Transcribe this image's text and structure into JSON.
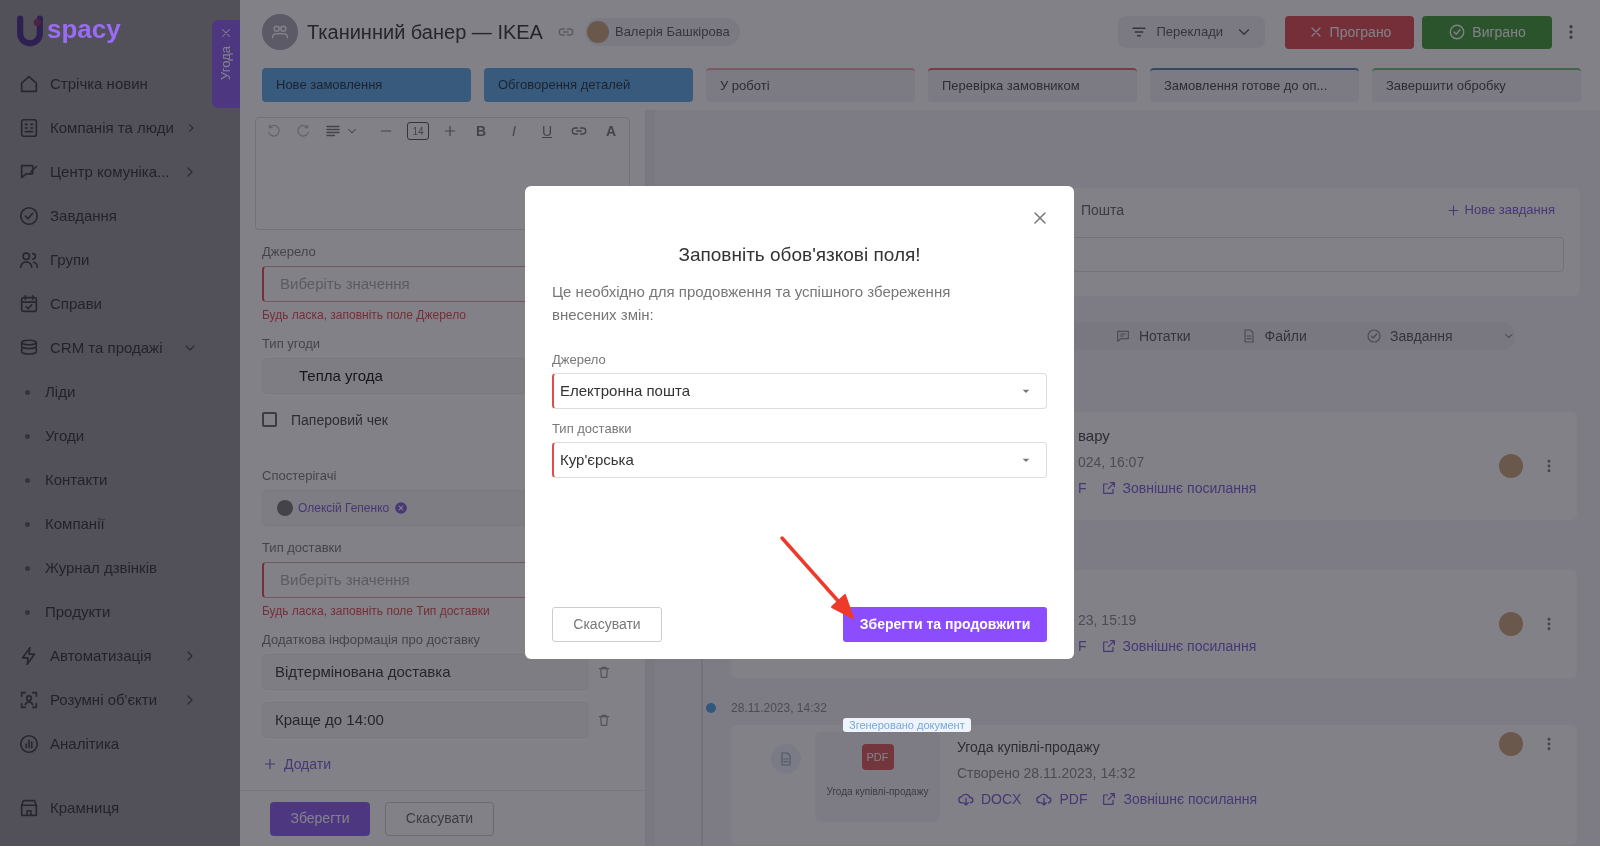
{
  "sidebar": {
    "logo": "spacy",
    "items": [
      {
        "label": "Стрічка новин"
      },
      {
        "label": "Компанія та люди",
        "expanded": false
      },
      {
        "label": "Центр комуніка...",
        "expanded": false
      },
      {
        "label": "Завдання"
      },
      {
        "label": "Групи"
      },
      {
        "label": "Справи"
      },
      {
        "label": "CRM та продажі",
        "expanded": true,
        "children": [
          {
            "label": "Ліди"
          },
          {
            "label": "Угоди"
          },
          {
            "label": "Контакти"
          },
          {
            "label": "Компанії"
          },
          {
            "label": "Журнал дзвінків"
          },
          {
            "label": "Продукти"
          }
        ]
      },
      {
        "label": "Автоматизація",
        "expanded": false
      },
      {
        "label": "Розумні об'єкти",
        "expanded": false
      },
      {
        "label": "Аналітика"
      },
      {
        "label": "Крамниця"
      }
    ]
  },
  "drawer_tab": {
    "label": "Угода"
  },
  "header": {
    "title": "Тканинний банер — IKEA",
    "owner": "Валерія Башкірова",
    "translations": "Переклади",
    "lost": "Програно",
    "won": "Виграно"
  },
  "stages": [
    {
      "label": "Нове замовлення",
      "done": true
    },
    {
      "label": "Обговорення деталей",
      "done": true
    },
    {
      "label": "У роботі",
      "done": false
    },
    {
      "label": "Перевірка замовником",
      "done": false
    },
    {
      "label": "Замовлення готове до оп...",
      "done": false
    },
    {
      "label": "Завершити обробку",
      "done": false
    }
  ],
  "form": {
    "editor": {
      "font_size": "14",
      "format": [
        "B",
        "I",
        "U",
        "A"
      ]
    },
    "fields": [
      {
        "kind": "select",
        "label": "Джерело",
        "placeholder": "Виберіть значення",
        "invalid": true,
        "error": "Будь ласка, заповніть поле Джерело"
      },
      {
        "kind": "select",
        "label": "Тип угоди",
        "value": "Тепла угода",
        "invalid": false
      },
      {
        "kind": "checkbox",
        "label": "Паперовий чек",
        "checked": false
      },
      {
        "kind": "people",
        "label": "Спостерігачі",
        "people": [
          "Олексій Гепенко"
        ]
      },
      {
        "kind": "select",
        "label": "Тип доставки",
        "placeholder": "Виберіть значення",
        "invalid": true,
        "error": "Будь ласка, заповніть поле Тип доставки"
      },
      {
        "kind": "list",
        "label": "Додаткова інформація про доставку",
        "values": [
          "Відтермінована доставка",
          "Краще до 14:00"
        ],
        "add": "Додати"
      }
    ],
    "save": "Зберегти",
    "cancel": "Скасувати"
  },
  "activity": {
    "tab": "Пошта",
    "new_task": "Нове завдання",
    "feed_tabs": [
      "Нотатки",
      "Файли",
      "Завдання"
    ],
    "entries": [
      {
        "kind": "partial",
        "title": "вару",
        "date": "024, 16:07",
        "links": [
          {
            "label": "F",
            "kind": "text"
          },
          {
            "label": "Зовнішнє посилання",
            "kind": "external"
          }
        ]
      },
      {
        "kind": "partial",
        "date": "23, 15:19",
        "links": [
          {
            "label": "F",
            "kind": "text"
          },
          {
            "label": "Зовнішнє посилання",
            "kind": "external"
          }
        ]
      },
      {
        "kind": "document",
        "time": "28.11.2023, 14:32",
        "tag": "Згенеровано документ",
        "badge": "PDF",
        "caption": "Угода купівлі-продажу",
        "title": "Угода купівлі-продажу",
        "date": "Створено 28.11.2023, 14:32",
        "links": [
          {
            "label": "DOCX",
            "kind": "download"
          },
          {
            "label": "PDF",
            "kind": "download"
          },
          {
            "label": "Зовнішнє посилання",
            "kind": "external"
          }
        ]
      }
    ]
  },
  "modal": {
    "title": "Заповніть обов'язкові поля!",
    "message": "Це необхідно для продовження та успішного збереження внесених змін:",
    "fields": [
      {
        "label": "Джерело",
        "value": "Електронна пошта",
        "invalid": true
      },
      {
        "label": "Тип доставки",
        "value": "Кур'єрська",
        "invalid": true
      }
    ],
    "cancel": "Скасувати",
    "confirm": "Зберегти та продовжити"
  }
}
